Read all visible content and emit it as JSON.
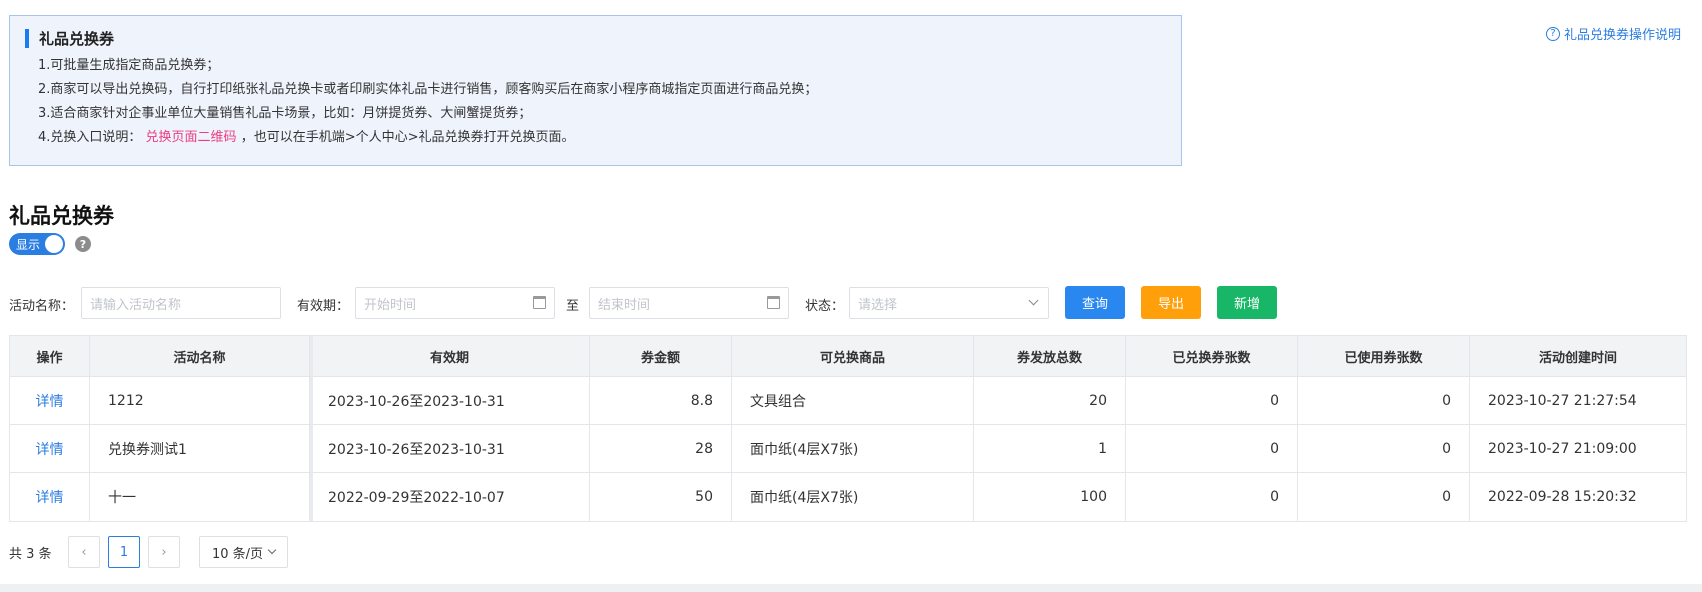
{
  "info": {
    "title": "礼品兑换券",
    "line1": "1.可批量生成指定商品兑换券；",
    "line2": "2.商家可以导出兑换码，自行打印纸张礼品兑换卡或者印刷实体礼品卡进行销售，顾客购买后在商家小程序商城指定页面进行商品兑换；",
    "line3": "3.适合商家针对企事业单位大量销售礼品卡场景，比如：月饼提货券、大闸蟹提货券；",
    "line4_prefix": "4.兑换入口说明：",
    "line4_link": "兑换页面二维码",
    "line4_suffix": "，也可以在手机端>个人中心>礼品兑换券打开兑换页面。"
  },
  "help_link": {
    "icon": "question-circle-icon",
    "label": "礼品兑换券操作说明"
  },
  "page_title": "礼品兑换券",
  "toggle": {
    "label": "显示",
    "on": true
  },
  "filters": {
    "name_label": "活动名称：",
    "name_placeholder": "请输入活动名称",
    "period_label": "有效期：",
    "start_placeholder": "开始时间",
    "to_label": "至",
    "end_placeholder": "结束时间",
    "status_label": "状态：",
    "status_placeholder": "请选择"
  },
  "buttons": {
    "query": "查询",
    "export": "导出",
    "add": "新增",
    "query_color": "#2a87f0",
    "export_color": "#ff9f0a",
    "add_color": "#18b767"
  },
  "table": {
    "headers": [
      "操作",
      "活动名称",
      "有效期",
      "券金额",
      "可兑换商品",
      "券发放总数",
      "已兑换券张数",
      "已使用券张数",
      "活动创建时间"
    ],
    "rows": [
      [
        "详情",
        "1212",
        "2023-10-26至2023-10-31",
        "8.8",
        "文具组合",
        "20",
        "0",
        "0",
        "2023-10-27 21:27:54"
      ],
      [
        "详情",
        "兑换券测试1",
        "2023-10-26至2023-10-31",
        "28",
        "面巾纸(4层X7张)",
        "1",
        "0",
        "0",
        "2023-10-27 21:09:00"
      ],
      [
        "详情",
        "十一",
        "2022-09-29至2022-10-07",
        "50",
        "面巾纸(4层X7张)",
        "100",
        "0",
        "0",
        "2022-09-28 15:20:32"
      ]
    ]
  },
  "pagination": {
    "total": "共 3 条",
    "prev": "‹",
    "current": "1",
    "next": "›",
    "page_size": "10 条/页"
  }
}
